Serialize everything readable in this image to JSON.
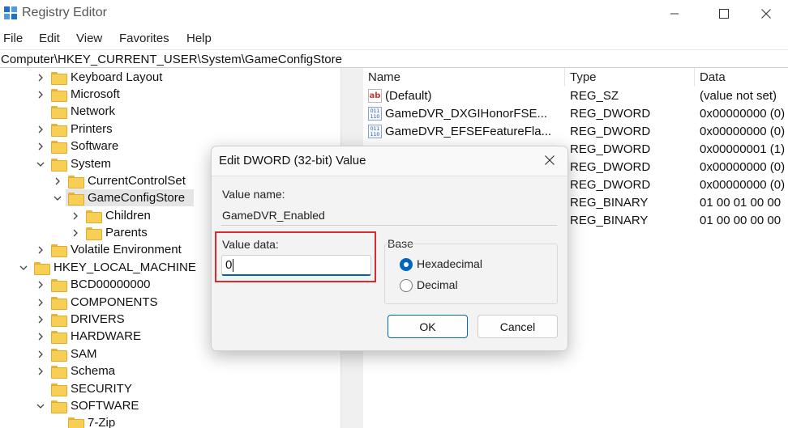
{
  "window": {
    "title": "Registry Editor"
  },
  "menu": [
    "File",
    "Edit",
    "View",
    "Favorites",
    "Help"
  ],
  "address": "Computer\\HKEY_CURRENT_USER\\System\\GameConfigStore",
  "tree": [
    {
      "label": "Keyboard Layout",
      "state": "collapsed"
    },
    {
      "label": "Microsoft",
      "state": "collapsed"
    },
    {
      "label": "Network",
      "state": "none"
    },
    {
      "label": "Printers",
      "state": "collapsed"
    },
    {
      "label": "Software",
      "state": "collapsed"
    },
    {
      "label": "System",
      "state": "expanded"
    },
    {
      "label": "CurrentControlSet",
      "state": "collapsed"
    },
    {
      "label": "GameConfigStore",
      "state": "expanded",
      "selected": true
    },
    {
      "label": "Children",
      "state": "collapsed"
    },
    {
      "label": "Parents",
      "state": "collapsed"
    },
    {
      "label": "Volatile Environment",
      "state": "collapsed"
    },
    {
      "label": "HKEY_LOCAL_MACHINE",
      "state": "expanded"
    },
    {
      "label": "BCD00000000",
      "state": "collapsed"
    },
    {
      "label": "COMPONENTS",
      "state": "collapsed"
    },
    {
      "label": "DRIVERS",
      "state": "collapsed"
    },
    {
      "label": "HARDWARE",
      "state": "collapsed"
    },
    {
      "label": "SAM",
      "state": "collapsed"
    },
    {
      "label": "Schema",
      "state": "collapsed"
    },
    {
      "label": "SECURITY",
      "state": "none"
    },
    {
      "label": "SOFTWARE",
      "state": "expanded"
    },
    {
      "label": "7-Zip",
      "state": "none"
    }
  ],
  "columns": {
    "name": "Name",
    "type": "Type",
    "data": "Data"
  },
  "values": [
    {
      "name": "(Default)",
      "type": "REG_SZ",
      "data": "(value not set)",
      "icon": "string-value-icon"
    },
    {
      "name": "GameDVR_DXGIHonorFSE...",
      "type": "REG_DWORD",
      "data": "0x00000000 (0)",
      "icon": "binary-value-icon"
    },
    {
      "name": "GameDVR_EFSEFeatureFla...",
      "type": "REG_DWORD",
      "data": "0x00000000 (0)",
      "icon": "binary-value-icon"
    },
    {
      "name": "",
      "type": "REG_DWORD",
      "data": "0x00000001 (1)",
      "icon": ""
    },
    {
      "name": "",
      "type": "REG_DWORD",
      "data": "0x00000000 (0)",
      "icon": ""
    },
    {
      "name": "",
      "type": "REG_DWORD",
      "data": "0x00000000 (0)",
      "icon": ""
    },
    {
      "name": "",
      "type": "REG_BINARY",
      "data": "01 00 01 00 00",
      "icon": ""
    },
    {
      "name": "",
      "type": "REG_BINARY",
      "data": "01 00 00 00 00",
      "icon": ""
    }
  ],
  "dialog": {
    "title": "Edit DWORD (32-bit) Value",
    "value_name_label": "Value name:",
    "value_name": "GameDVR_Enabled",
    "value_data_label": "Value data:",
    "value_data": "0",
    "base_label": "Base",
    "hex_label": "Hexadecimal",
    "dec_label": "Decimal",
    "selected_base": "Hexadecimal",
    "ok_label": "OK",
    "cancel_label": "Cancel"
  },
  "colors": {
    "accent": "#0067c0",
    "highlight_frame": "#d32f2f",
    "folder": "#f7cf55"
  }
}
